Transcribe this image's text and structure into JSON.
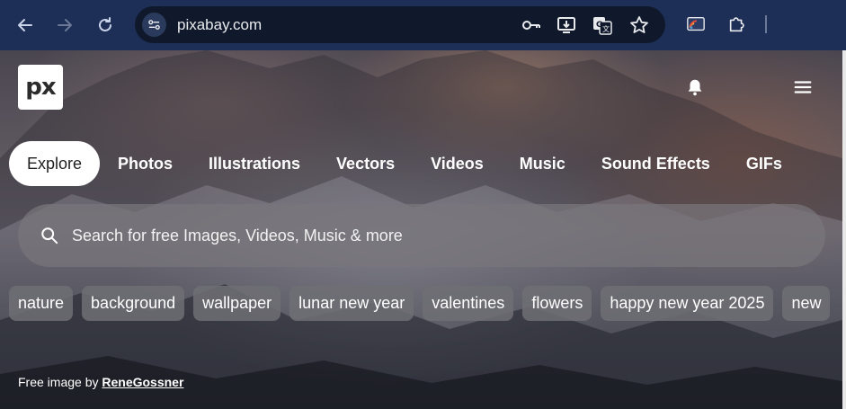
{
  "browser": {
    "url": "pixabay.com"
  },
  "logo": {
    "text": "px"
  },
  "tabs": [
    {
      "label": "Explore",
      "active": true
    },
    {
      "label": "Photos",
      "active": false
    },
    {
      "label": "Illustrations",
      "active": false
    },
    {
      "label": "Vectors",
      "active": false
    },
    {
      "label": "Videos",
      "active": false
    },
    {
      "label": "Music",
      "active": false
    },
    {
      "label": "Sound Effects",
      "active": false
    },
    {
      "label": "GIFs",
      "active": false
    }
  ],
  "search": {
    "placeholder": "Search for free Images, Videos, Music & more"
  },
  "chips": [
    "nature",
    "background",
    "wallpaper",
    "lunar new year",
    "valentines",
    "flowers",
    "happy new year 2025",
    "new"
  ],
  "credit": {
    "prefix": "Free image by",
    "author": "ReneGossner"
  },
  "colors": {
    "chrome_bg": "#1d2f57",
    "omnibox_bg": "#10192b",
    "active_tab_bg": "#ffffff"
  }
}
